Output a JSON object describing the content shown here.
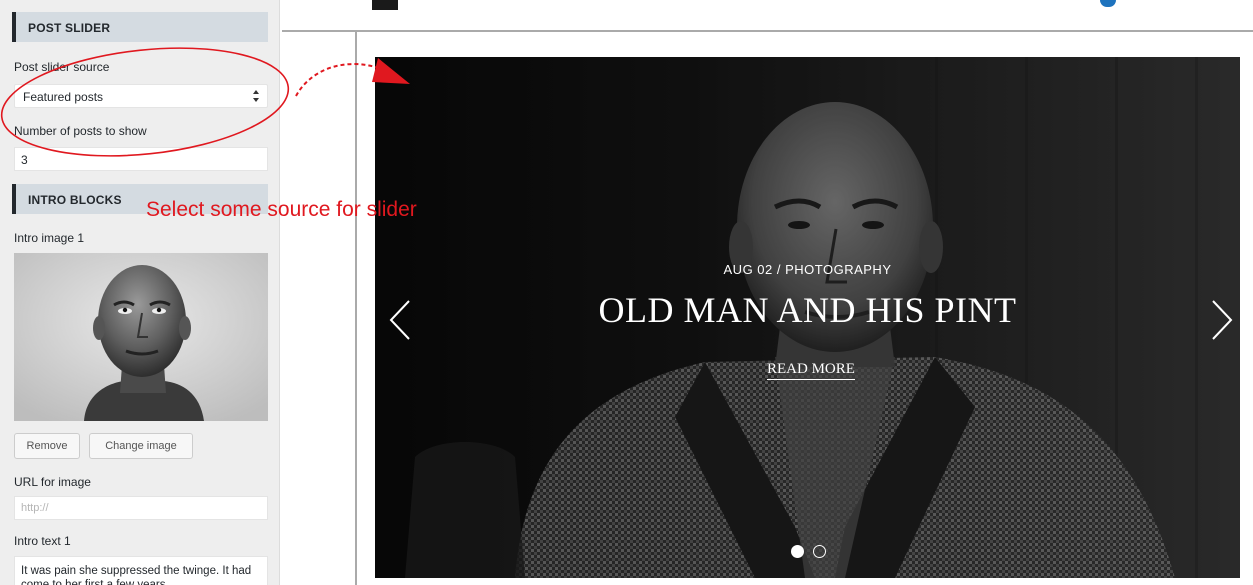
{
  "sidebar": {
    "post_slider": {
      "section_title": "POST SLIDER",
      "source_label": "Post slider source",
      "source_value": "Featured posts",
      "count_label": "Number of posts to show",
      "count_value": "3"
    },
    "intro_blocks": {
      "section_title": "INTRO BLOCKS",
      "image_label": "Intro image 1",
      "remove_label": "Remove",
      "change_image_label": "Change image",
      "url_label": "URL for image",
      "url_placeholder": "http://",
      "text_label": "Intro text 1",
      "text_value": "It was pain she suppressed the twinge. It had come to her first a few years"
    }
  },
  "annotation": {
    "text": "Select some source for slider",
    "color": "#e0181f"
  },
  "slider": {
    "meta": "AUG 02 / PHOTOGRAPHY",
    "title": "OLD MAN AND HIS PINT",
    "read_more": "READ MORE",
    "slide_count": 2,
    "active_slide": 1
  },
  "icons": [
    "select-arrows-icon",
    "chevron-left-icon",
    "chevron-right-icon",
    "annotation-arrow-icon"
  ]
}
